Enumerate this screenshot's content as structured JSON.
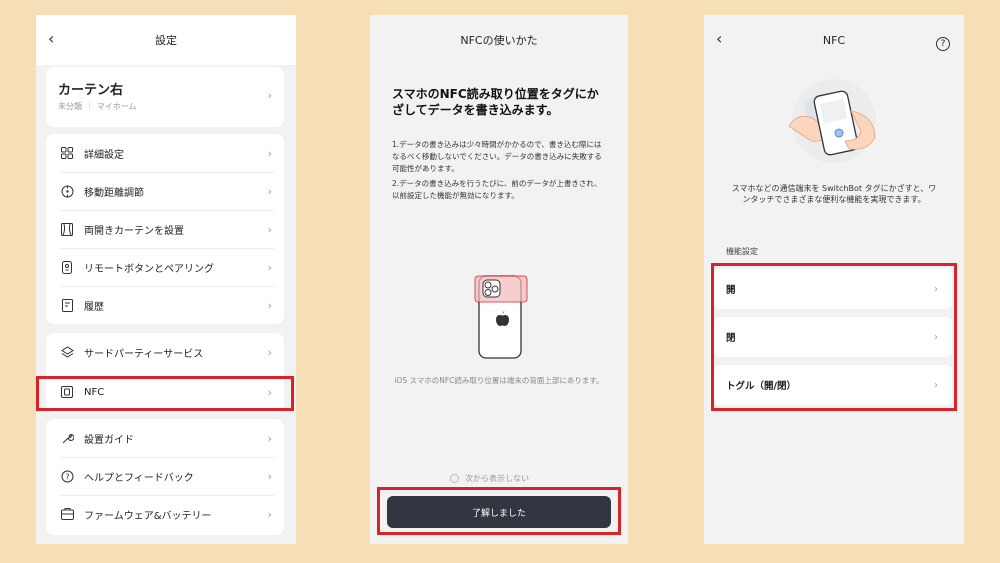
{
  "panel1": {
    "title": "設定",
    "back_icon": "‹",
    "device": {
      "name": "カーテン右",
      "category": "未分類",
      "home": "マイホーム"
    },
    "group1": [
      {
        "label": "詳細設定",
        "icon": "grid-icon"
      },
      {
        "label": "移動距離調節",
        "icon": "target-icon"
      },
      {
        "label": "両開きカーテンを設置",
        "icon": "curtain-icon"
      },
      {
        "label": "リモートボタンとペアリング",
        "icon": "remote-icon"
      },
      {
        "label": "履歴",
        "icon": "history-icon"
      }
    ],
    "group2": [
      {
        "label": "サードパーティーサービス",
        "icon": "layers-icon"
      },
      {
        "label": "NFC",
        "icon": "nfc-icon"
      }
    ],
    "group3": [
      {
        "label": "設置ガイド",
        "icon": "wrench-icon"
      },
      {
        "label": "ヘルプとフィードバック",
        "icon": "help-icon"
      },
      {
        "label": "ファームウェア&バッテリー",
        "icon": "firmware-icon"
      }
    ]
  },
  "panel2": {
    "title": "NFCの使いかた",
    "heading": "スマホのNFC読み取り位置をタグにかざしてデータを書き込みます。",
    "note1": "1.データの書き込みは少々時間がかかるので、書き込む際にはなるべく移動しないでください。データの書き込みに失敗する可能性があります。",
    "note2": "2.データの書き込みを行うたびに、前のデータが上書きされ、以前設定した機能が無効になります。",
    "caption": "iOS スマホのNFC読み取り位置は端末の背面上部にあります。",
    "checkbox_label": "次から表示しない",
    "confirm_button": "了解しました"
  },
  "panel3": {
    "title": "NFC",
    "description": "スマホなどの通信端末を SwitchBot タグにかざすと、ワンタッチでさまざまな便利な機能を実現できます。",
    "section_label": "機能設定",
    "options": [
      "開",
      "閉",
      "トグル（開/閉）"
    ]
  },
  "colors": {
    "highlight": "#d8232a",
    "background": "#f6dfb6",
    "button": "#333640"
  }
}
